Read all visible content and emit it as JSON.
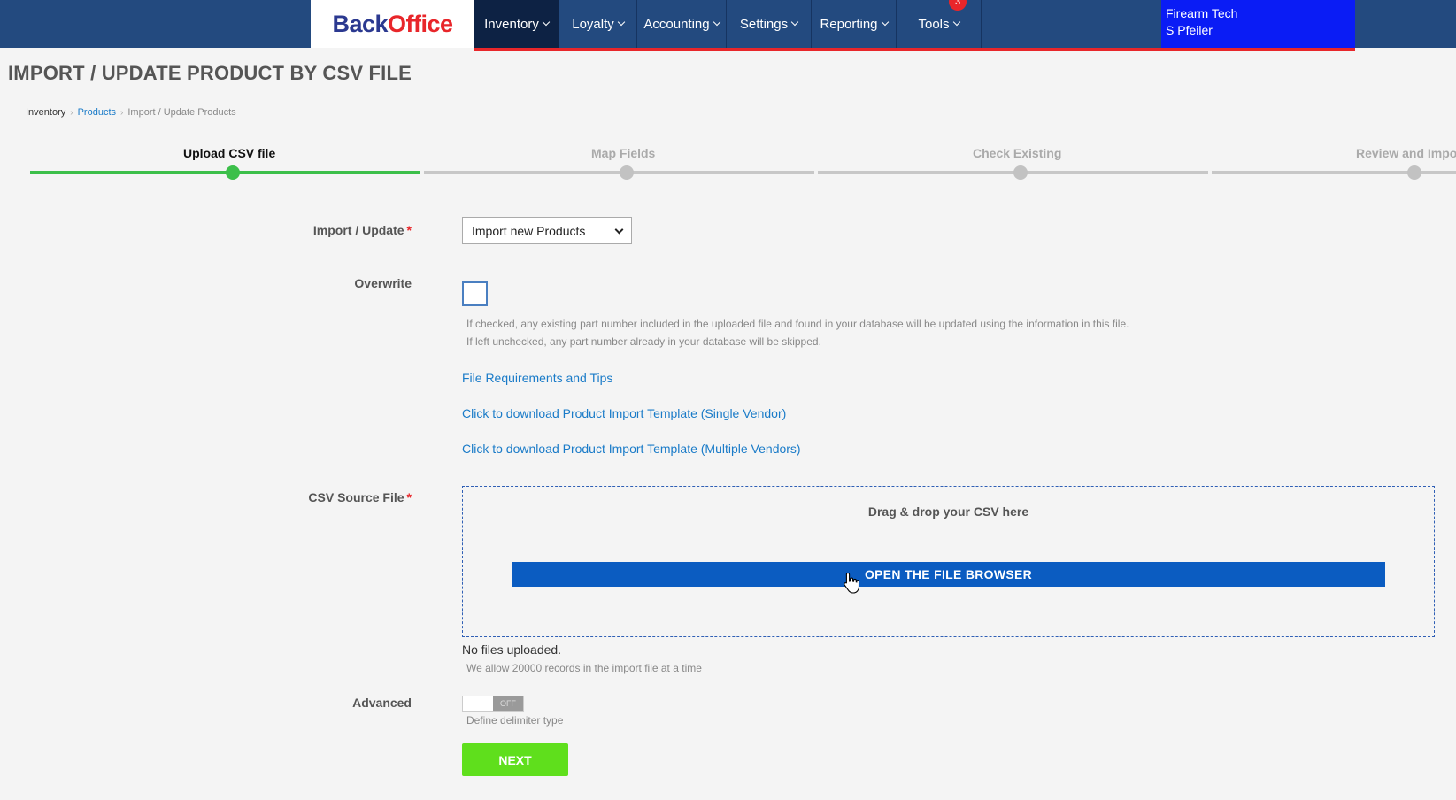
{
  "logo": {
    "part1": "Back",
    "part2": "Office"
  },
  "nav": {
    "items": [
      {
        "label": "Inventory"
      },
      {
        "label": "Loyalty"
      },
      {
        "label": "Accounting"
      },
      {
        "label": "Settings"
      },
      {
        "label": "Reporting"
      },
      {
        "label": "Tools",
        "badge": "3"
      }
    ]
  },
  "user": {
    "company": "Firearm Tech",
    "name": "S Pfeiler"
  },
  "page": {
    "title": "IMPORT / UPDATE PRODUCT BY CSV FILE"
  },
  "breadcrumb": {
    "item1": "Inventory",
    "item2": "Products",
    "item3": "Import / Update Products"
  },
  "wizard": {
    "steps": [
      {
        "label": "Upload CSV file"
      },
      {
        "label": "Map Fields"
      },
      {
        "label": "Check Existing"
      },
      {
        "label": "Review and Import"
      }
    ]
  },
  "form": {
    "import_update_label": "Import / Update",
    "required_mark": "*",
    "import_update_value": "Import new Products",
    "overwrite_label": "Overwrite",
    "overwrite_help_1": "If checked, any existing part number included in the uploaded file and found in your database will be updated using the information in this file.",
    "overwrite_help_2": "If left unchecked, any part number already in your database will be skipped.",
    "link_requirements": "File Requirements and Tips",
    "link_single_vendor": "Click to download Product Import Template (Single Vendor)",
    "link_multiple_vendors": "Click to download Product Import Template (Multiple Vendors)",
    "csv_label": "CSV Source File",
    "dropzone_text": "Drag & drop your CSV here",
    "file_browser_button": "OPEN THE FILE BROWSER",
    "no_files": "No files uploaded.",
    "records_limit": "We allow 20000 records in the import file at a time",
    "advanced_label": "Advanced",
    "toggle_state": "OFF",
    "delimiter_help": "Define delimiter type",
    "next_button": "NEXT"
  },
  "colors": {
    "nav_bg": "#234a7f",
    "accent_red": "#e8262a",
    "user_box": "#0a1cf5",
    "step_active": "#3cbf4a",
    "primary_button": "#0b5cc1",
    "next_button": "#5fdf1c",
    "link": "#1a7bc8"
  }
}
